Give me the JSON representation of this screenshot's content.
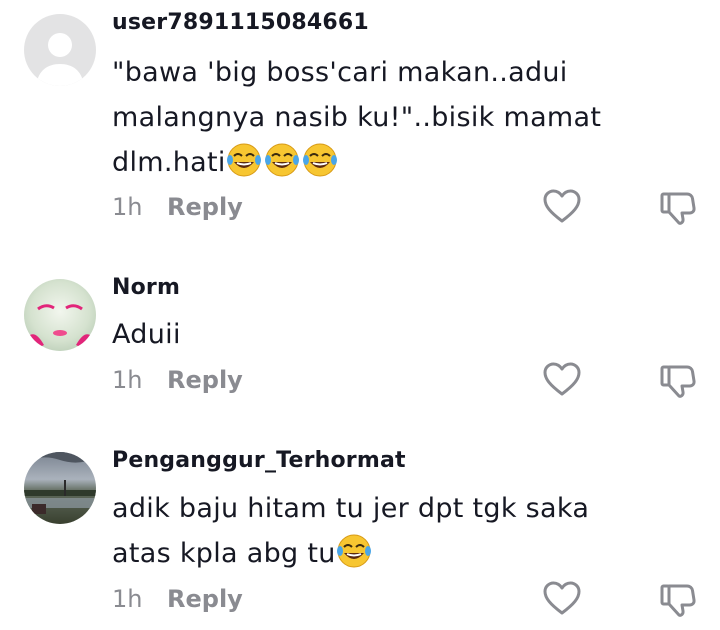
{
  "comments": [
    {
      "username": "user7891115084661",
      "text": "\"bawa 'big boss'cari makan..adui malangnya nasib ku!\"..bisik mamat dlm.hati",
      "emoji": [
        "laughing-tears-emoji",
        "laughing-tears-emoji",
        "laughing-tears-emoji"
      ],
      "time": "1h",
      "reply": "Reply"
    },
    {
      "username": "Norm",
      "text": "Aduii",
      "time": "1h",
      "reply": "Reply"
    },
    {
      "username": "Penganggur_Terhormat",
      "text": "adik baju hitam tu jer dpt tgk saka atas kpla abg tu",
      "emoji": [
        "laughing-tears-emoji"
      ],
      "time": "1h",
      "reply": "Reply"
    }
  ],
  "icons": {
    "like": "heart-outline-icon",
    "dislike": "thumbs-down-outline-icon"
  },
  "colors": {
    "text": "#161823",
    "muted": "#8a8b91",
    "placeholder_avatar": "#e3e3e4"
  }
}
